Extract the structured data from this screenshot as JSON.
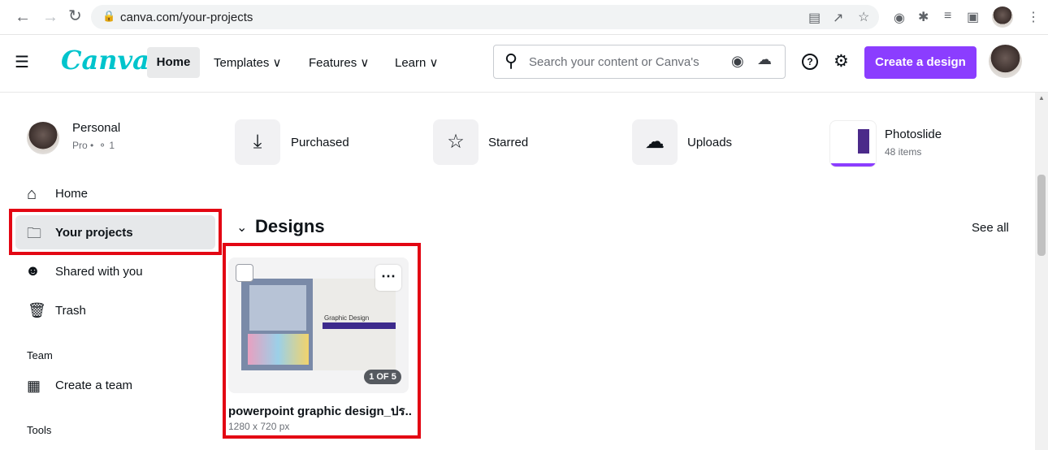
{
  "browser": {
    "url": "canva.com/your-projects"
  },
  "header": {
    "logo": "Canva",
    "nav": {
      "home": "Home",
      "templates": "Templates ∨",
      "features": "Features ∨",
      "learn": "Learn ∨"
    },
    "search_placeholder": "Search your content or Canva's",
    "create_button": "Create a design"
  },
  "account": {
    "name": "Personal",
    "plan": "Pro •  ⚬ 1"
  },
  "quick_links": [
    {
      "label": "Purchased",
      "icon": "download-icon"
    },
    {
      "label": "Starred",
      "icon": "star-icon"
    },
    {
      "label": "Uploads",
      "icon": "cloud-upload-icon"
    }
  ],
  "folder": {
    "name": "Photoslide",
    "count": "48 items"
  },
  "sidebar": {
    "items": [
      {
        "label": "Home",
        "icon": "home-icon"
      },
      {
        "label": "Your projects",
        "icon": "folder-icon"
      },
      {
        "label": "Shared with you",
        "icon": "shared-users-icon"
      },
      {
        "label": "Trash",
        "icon": "trash-icon"
      }
    ],
    "team_heading": "Team",
    "create_team": "Create a team",
    "tools_heading": "Tools"
  },
  "designs": {
    "heading": "Designs",
    "see_all": "See all",
    "card": {
      "title": "powerpoint graphic design_ปร..",
      "size": "1280 x 720 px",
      "pager": "1 OF 5",
      "thumb_title": "Graphic Design"
    }
  },
  "colors": {
    "accent": "#8b3dff",
    "brand": "#00c4cc",
    "highlight": "#e30613"
  }
}
